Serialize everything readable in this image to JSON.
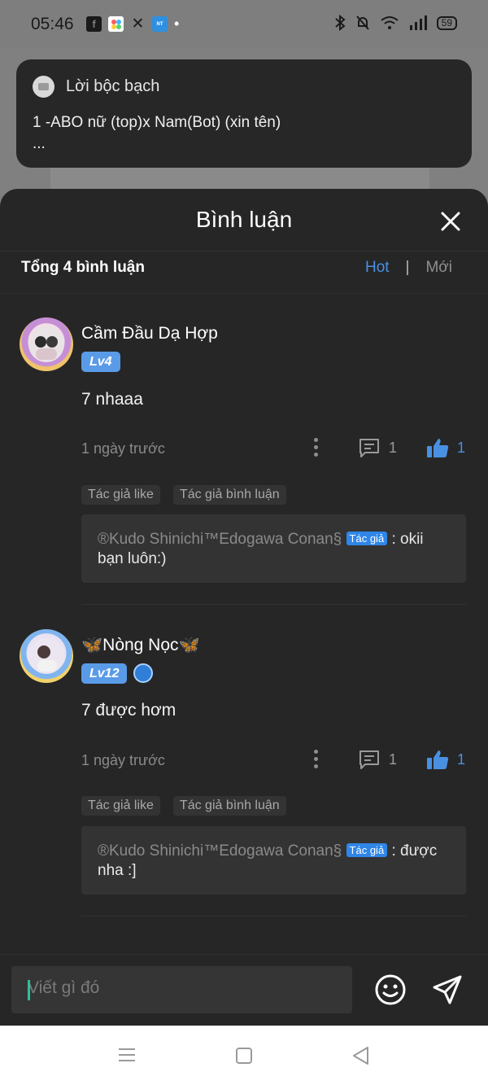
{
  "status_bar": {
    "time": "05:46",
    "apps": [
      "facebook-icon",
      "gallery-icon",
      "x-icon",
      "novel-toon-icon"
    ],
    "dot": "•",
    "battery": "59"
  },
  "toast": {
    "title": "Lời bộc bạch",
    "text": "1 -ABO nữ (top)x Nam(Bot) (xin tên)",
    "ellipsis": "..."
  },
  "sheet": {
    "title": "Bình luận",
    "total": "Tổng 4 bình luận",
    "sort_hot": "Hot",
    "sort_sep": "|",
    "sort_new": "Mới"
  },
  "comments": [
    {
      "username": "Cầm Đầu Dạ Hợp",
      "level": "Lv4",
      "text": "7 nhaaa",
      "time": "1 ngày trước",
      "reply_count": "1",
      "like_count": "1",
      "tags": [
        "Tác giả like",
        "Tác giả bình luận"
      ],
      "reply_author": "®Kudo Shinichi™Edogawa Conan§",
      "reply_badge": "Tác giả",
      "reply_text": " : okii bạn luôn:)"
    },
    {
      "username": "🦋Nòng Nọc🦋",
      "level": "Lv12",
      "text": "7 được hơm",
      "time": "1 ngày trước",
      "reply_count": "1",
      "like_count": "1",
      "tags": [
        "Tác giả like",
        "Tác giả bình luận"
      ],
      "reply_author": "®Kudo Shinichi™Edogawa Conan§",
      "reply_badge": "Tác giả",
      "reply_text": " : được nha :]"
    }
  ],
  "input": {
    "placeholder": "Viết gì đó"
  },
  "colors": {
    "accent": "#4a90e2",
    "sheet_bg": "#262626",
    "level_badge": "#5a9be8",
    "caret": "#29c29d"
  }
}
